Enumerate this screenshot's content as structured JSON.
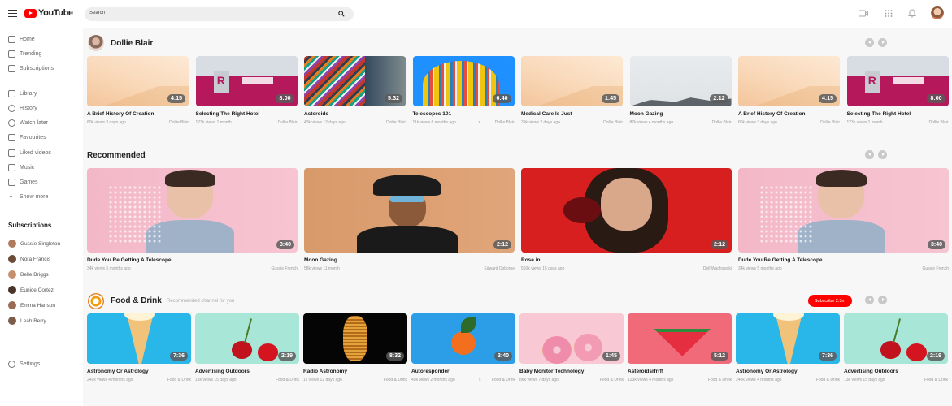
{
  "header": {
    "logo_text": "YouTube",
    "search_placeholder": "Search",
    "icons": [
      "menu-icon",
      "video-camera-icon",
      "apps-grid-icon",
      "bell-icon",
      "avatar"
    ]
  },
  "sidebar": {
    "items": [
      {
        "label": "Home",
        "icon": "home-icon"
      },
      {
        "label": "Trending",
        "icon": "fire-icon"
      },
      {
        "label": "Subscriptions",
        "icon": "subscriptions-icon"
      },
      {
        "label": "Library",
        "icon": "folder-icon"
      },
      {
        "label": "History",
        "icon": "history-icon"
      },
      {
        "label": "Watch later",
        "icon": "clock-icon"
      },
      {
        "label": "Favourites",
        "icon": "star-icon"
      },
      {
        "label": "Liked videos",
        "icon": "heart-icon"
      },
      {
        "label": "Music",
        "icon": "music-icon"
      },
      {
        "label": "Games",
        "icon": "gamepad-icon"
      },
      {
        "label": "Show more",
        "icon": "chevron-down-icon"
      }
    ],
    "subscriptions_title": "Subscriptions",
    "subscriptions": [
      {
        "name": "Gussie Singleton",
        "color": "#b07a5e"
      },
      {
        "name": "Nora Francis",
        "color": "#6b4a3a"
      },
      {
        "name": "Belle Briggs",
        "color": "#c58e6d"
      },
      {
        "name": "Eunice Cortez",
        "color": "#4a3328"
      },
      {
        "name": "Emma Hanson",
        "color": "#9a6a55"
      },
      {
        "name": "Leah Berry",
        "color": "#7d5c4c"
      }
    ],
    "settings_label": "Settings"
  },
  "sections": {
    "dollie": {
      "title": "Dollie Blair",
      "videos": [
        {
          "title": "A Brief History Of Creation",
          "meta": "80k views  3 days ago",
          "channel": "Dollie Blair",
          "duration": "4:15",
          "thumb": "peach"
        },
        {
          "title": "Selecting The Right Hotel",
          "meta": "123k views  1 month",
          "channel": "Dollie Blair",
          "duration": "8:00",
          "thumb": "hotel"
        },
        {
          "title": "Asteroids",
          "meta": "43k views  12 days ago",
          "channel": "Dollie Blair",
          "duration": "5:32",
          "thumb": "stripes"
        },
        {
          "title": "Telescopes 101",
          "meta": "11k views  6 months ago",
          "channel": "Dollie Blair",
          "duration": "6:40",
          "thumb": "building",
          "extra": "x"
        },
        {
          "title": "Medical Care Is Just",
          "meta": "39k views  2 days ago",
          "channel": "Dollie Blair",
          "duration": "1:45",
          "thumb": "peach"
        },
        {
          "title": "Moon Gazing",
          "meta": "87k views  4 months ago",
          "channel": "Dollie Blair",
          "duration": "2:12",
          "thumb": "moon"
        },
        {
          "title": "A Brief History Of Creation",
          "meta": "80k views  3 days ago",
          "channel": "Dollie Blair",
          "duration": "4:15",
          "thumb": "peach"
        },
        {
          "title": "Selecting The Right Hotel",
          "meta": "123k views  1 month",
          "channel": "Dollie Blair",
          "duration": "8:00",
          "thumb": "hotel"
        }
      ]
    },
    "recommended": {
      "title": "Recommended",
      "videos": [
        {
          "title": "Dude You Re Getting A Telescope",
          "meta": "34k views  5 months ago",
          "channel": "Gussie French",
          "duration": "3:40",
          "thumb": "man-pink"
        },
        {
          "title": "Moon Gazing",
          "meta": "58k views  11 month",
          "channel": "Edward Osborne",
          "duration": "2:12",
          "thumb": "man-hat"
        },
        {
          "title": "Rose in",
          "meta": "560k views  15 days ago",
          "channel": "Dell Wachowski",
          "duration": "2:12",
          "thumb": "woman-red"
        },
        {
          "title": "Dude You Re Getting A Telescope",
          "meta": "34k views  5 months ago",
          "channel": "Gussie French",
          "duration": "3:40",
          "thumb": "man-pink"
        }
      ]
    },
    "food": {
      "title": "Food & Drink",
      "subtitle": "Recommended channel for you",
      "subscribe_label": "Subscribe 2.3m",
      "videos": [
        {
          "title": "Astronomy Or Astrology",
          "meta": "240k views  4 months ago",
          "channel": "Food & Drink",
          "duration": "7:36",
          "thumb": "icecream"
        },
        {
          "title": "Advertising Outdoors",
          "meta": "13k views  15 days ago",
          "channel": "Food & Drink",
          "duration": "2:19",
          "thumb": "cherries"
        },
        {
          "title": "Radio Astronomy",
          "meta": "1k views  12 days ago",
          "channel": "Food & Drink",
          "duration": "8:32",
          "thumb": "spaghetti"
        },
        {
          "title": "Autoresponder",
          "meta": "45k views  2 months ago",
          "channel": "Food & Drink",
          "duration": "3:40",
          "thumb": "orange",
          "extra": "x"
        },
        {
          "title": "Baby Monitor Technology",
          "meta": "86k views  7 days ago",
          "channel": "Food & Drink",
          "duration": "1:45",
          "thumb": "donuts"
        },
        {
          "title": "Asteroidsrfrrff",
          "meta": "123k views  4 months ago",
          "channel": "Food & Drink",
          "duration": "5:12",
          "thumb": "watermelon"
        },
        {
          "title": "Astronomy Or Astrology",
          "meta": "240k views  4 months ago",
          "channel": "Food & Drink",
          "duration": "7:36",
          "thumb": "icecream"
        },
        {
          "title": "Advertising Outdoors",
          "meta": "13k views  15 days ago",
          "channel": "Food & Drink",
          "duration": "2:19",
          "thumb": "cherries"
        }
      ]
    }
  },
  "colors": {
    "accent": "#ff0000",
    "main_bg": "#f7f7f7"
  }
}
